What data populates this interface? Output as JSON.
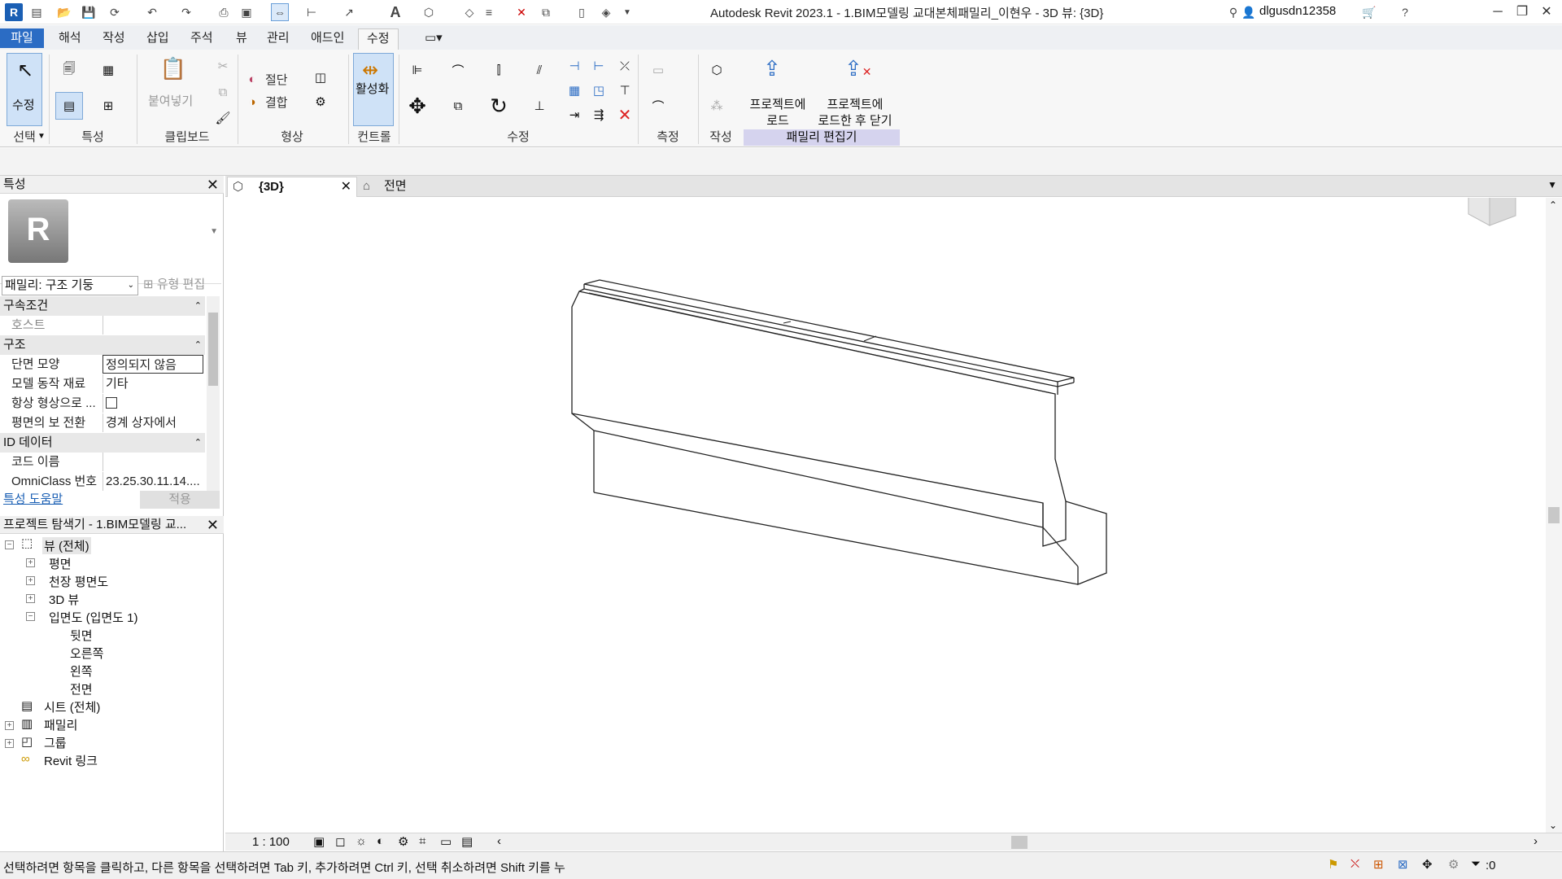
{
  "title_bar": {
    "title": "Autodesk Revit 2023.1 - 1.BIM모델링 교대본체패밀리_이현우 - 3D 뷰: {3D}",
    "username": "dlgusdn12358"
  },
  "tabs": [
    "파일",
    "해석",
    "작성",
    "삽입",
    "주석",
    "뷰",
    "관리",
    "애드인",
    "수정"
  ],
  "active_tab": "수정",
  "ribbon": {
    "select_panel": {
      "modify_label": "수정",
      "select_label": "선택"
    },
    "properties_panel_label": "특성",
    "clipboard": {
      "paste_label": "붙여넣기",
      "panel_label": "클립보드"
    },
    "geometry": {
      "cut_label": "절단",
      "join_label": "결합",
      "panel_label": "형상"
    },
    "controls": {
      "activate_label": "활성화",
      "panel_label": "컨트롤"
    },
    "modify_panel_label": "수정",
    "measure_panel_label": "측정",
    "create_panel_label": "작성",
    "family_editor": {
      "load_label_1": "프로젝트에",
      "load_label_2": "로드",
      "load_close_label_1": "프로젝트에",
      "load_close_label_2": "로드한 후 닫기",
      "panel_label": "패밀리 편집기"
    }
  },
  "properties_palette": {
    "header": "특성",
    "type_selector": "패밀리: 구조 기둥",
    "edit_type": "유형 편집",
    "categories": [
      {
        "name": "구속조건",
        "rows": [
          {
            "name": "호스트",
            "value": ""
          }
        ]
      },
      {
        "name": "구조",
        "rows": [
          {
            "name": "단면 모양",
            "value": "정의되지 않음"
          },
          {
            "name": "모델 동작 재료",
            "value": "기타"
          },
          {
            "name": "항상 형상으로 ...",
            "value": ""
          },
          {
            "name": "평면의 보 전환",
            "value": "경계 상자에서"
          }
        ]
      },
      {
        "name": "ID 데이터",
        "rows": [
          {
            "name": "코드 이름",
            "value": ""
          },
          {
            "name": "OmniClass 번호",
            "value": "23.25.30.11.14...."
          }
        ]
      }
    ],
    "help_link": "특성 도움말",
    "apply": "적용"
  },
  "project_browser": {
    "header": "프로젝트 탐색기 - 1.BIM모델링 교...",
    "items": [
      {
        "label": "뷰 (전체)",
        "level": 0
      },
      {
        "label": "평면",
        "level": 1
      },
      {
        "label": "천장 평면도",
        "level": 1
      },
      {
        "label": "3D 뷰",
        "level": 1
      },
      {
        "label": "입면도 (입면도 1)",
        "level": 1
      },
      {
        "label": "뒷면",
        "level": 2
      },
      {
        "label": "오른쪽",
        "level": 2
      },
      {
        "label": "왼쪽",
        "level": 2
      },
      {
        "label": "전면",
        "level": 2
      },
      {
        "label": "시트 (전체)",
        "level": 0
      },
      {
        "label": "패밀리",
        "level": 0
      },
      {
        "label": "그룹",
        "level": 0
      },
      {
        "label": "Revit 링크",
        "level": 0
      }
    ]
  },
  "view_tabs": [
    {
      "label": "{3D}",
      "active": true
    },
    {
      "label": "전면",
      "active": false
    }
  ],
  "view_bar": {
    "scale": "1 : 100"
  },
  "status_bar": {
    "message": "선택하려면 항목을 클릭하고, 다른 항목을 선택하려면 Tab 키, 추가하려면 Ctrl 키, 선택 취소하려면 Shift 키를 누",
    "filter_count": ":0"
  },
  "colors": {
    "accent": "#2b6cc4",
    "family_editor_band": "#d5d3ee",
    "revit_logo": "#1a5fb4"
  }
}
